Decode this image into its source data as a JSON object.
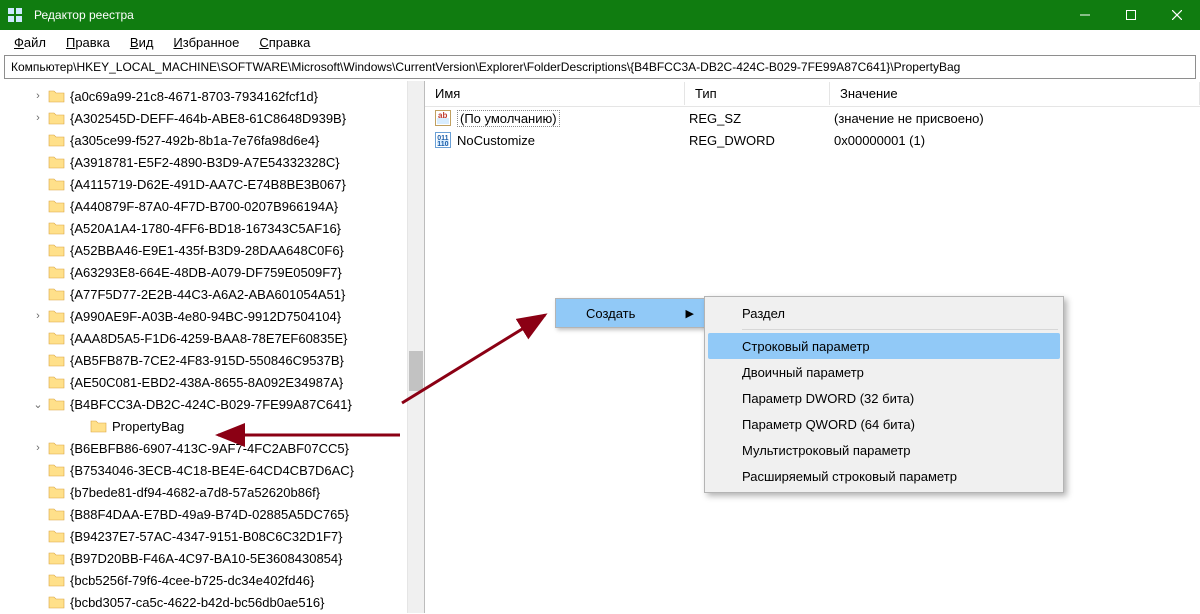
{
  "window": {
    "title": "Редактор реестра"
  },
  "menu": {
    "items": [
      "Файл",
      "Правка",
      "Вид",
      "Избранное",
      "Справка"
    ]
  },
  "address": "Компьютер\\HKEY_LOCAL_MACHINE\\SOFTWARE\\Microsoft\\Windows\\CurrentVersion\\Explorer\\FolderDescriptions\\{B4BFCC3A-DB2C-424C-B029-7FE99A87C641}\\PropertyBag",
  "tree": [
    {
      "exp": ">",
      "label": "{a0c69a99-21c8-4671-8703-7934162fcf1d}",
      "depth": 0
    },
    {
      "exp": ">",
      "label": "{A302545D-DEFF-464b-ABE8-61C8648D939B}",
      "depth": 0
    },
    {
      "exp": "",
      "label": "{a305ce99-f527-492b-8b1a-7e76fa98d6e4}",
      "depth": 0
    },
    {
      "exp": "",
      "label": "{A3918781-E5F2-4890-B3D9-A7E54332328C}",
      "depth": 0
    },
    {
      "exp": "",
      "label": "{A4115719-D62E-491D-AA7C-E74B8BE3B067}",
      "depth": 0
    },
    {
      "exp": "",
      "label": "{A440879F-87A0-4F7D-B700-0207B966194A}",
      "depth": 0
    },
    {
      "exp": "",
      "label": "{A520A1A4-1780-4FF6-BD18-167343C5AF16}",
      "depth": 0
    },
    {
      "exp": "",
      "label": "{A52BBA46-E9E1-435f-B3D9-28DAA648C0F6}",
      "depth": 0
    },
    {
      "exp": "",
      "label": "{A63293E8-664E-48DB-A079-DF759E0509F7}",
      "depth": 0
    },
    {
      "exp": "",
      "label": "{A77F5D77-2E2B-44C3-A6A2-ABA601054A51}",
      "depth": 0
    },
    {
      "exp": ">",
      "label": "{A990AE9F-A03B-4e80-94BC-9912D7504104}",
      "depth": 0
    },
    {
      "exp": "",
      "label": "{AAA8D5A5-F1D6-4259-BAA8-78E7EF60835E}",
      "depth": 0
    },
    {
      "exp": "",
      "label": "{AB5FB87B-7CE2-4F83-915D-550846C9537B}",
      "depth": 0
    },
    {
      "exp": "",
      "label": "{AE50C081-EBD2-438A-8655-8A092E34987A}",
      "depth": 0
    },
    {
      "exp": "v",
      "label": "{B4BFCC3A-DB2C-424C-B029-7FE99A87C641}",
      "depth": 0
    },
    {
      "exp": "",
      "label": "PropertyBag",
      "depth": 1
    },
    {
      "exp": ">",
      "label": "{B6EBFB86-6907-413C-9AF7-4FC2ABF07CC5}",
      "depth": 0
    },
    {
      "exp": "",
      "label": "{B7534046-3ECB-4C18-BE4E-64CD4CB7D6AC}",
      "depth": 0
    },
    {
      "exp": "",
      "label": "{b7bede81-df94-4682-a7d8-57a52620b86f}",
      "depth": 0
    },
    {
      "exp": "",
      "label": "{B88F4DAA-E7BD-49a9-B74D-02885A5DC765}",
      "depth": 0
    },
    {
      "exp": "",
      "label": "{B94237E7-57AC-4347-9151-B08C6C32D1F7}",
      "depth": 0
    },
    {
      "exp": "",
      "label": "{B97D20BB-F46A-4C97-BA10-5E3608430854}",
      "depth": 0
    },
    {
      "exp": "",
      "label": "{bcb5256f-79f6-4cee-b725-dc34e402fd46}",
      "depth": 0
    },
    {
      "exp": "",
      "label": "{bcbd3057-ca5c-4622-b42d-bc56db0ae516}",
      "depth": 0
    }
  ],
  "values": {
    "headers": {
      "name": "Имя",
      "type": "Тип",
      "value": "Значение"
    },
    "rows": [
      {
        "kind": "sz",
        "name": "(По умолчанию)",
        "type": "REG_SZ",
        "value": "(значение не присвоено)"
      },
      {
        "kind": "dword",
        "name": "NoCustomize",
        "type": "REG_DWORD",
        "value": "0x00000001 (1)"
      }
    ]
  },
  "context": {
    "parent": {
      "label": "Создать"
    },
    "children": [
      {
        "label": "Раздел"
      },
      {
        "sep": true
      },
      {
        "label": "Строковый параметр",
        "hover": true
      },
      {
        "label": "Двоичный параметр"
      },
      {
        "label": "Параметр DWORD (32 бита)"
      },
      {
        "label": "Параметр QWORD (64 бита)"
      },
      {
        "label": "Мультистроковый параметр"
      },
      {
        "label": "Расширяемый строковый параметр"
      }
    ]
  }
}
